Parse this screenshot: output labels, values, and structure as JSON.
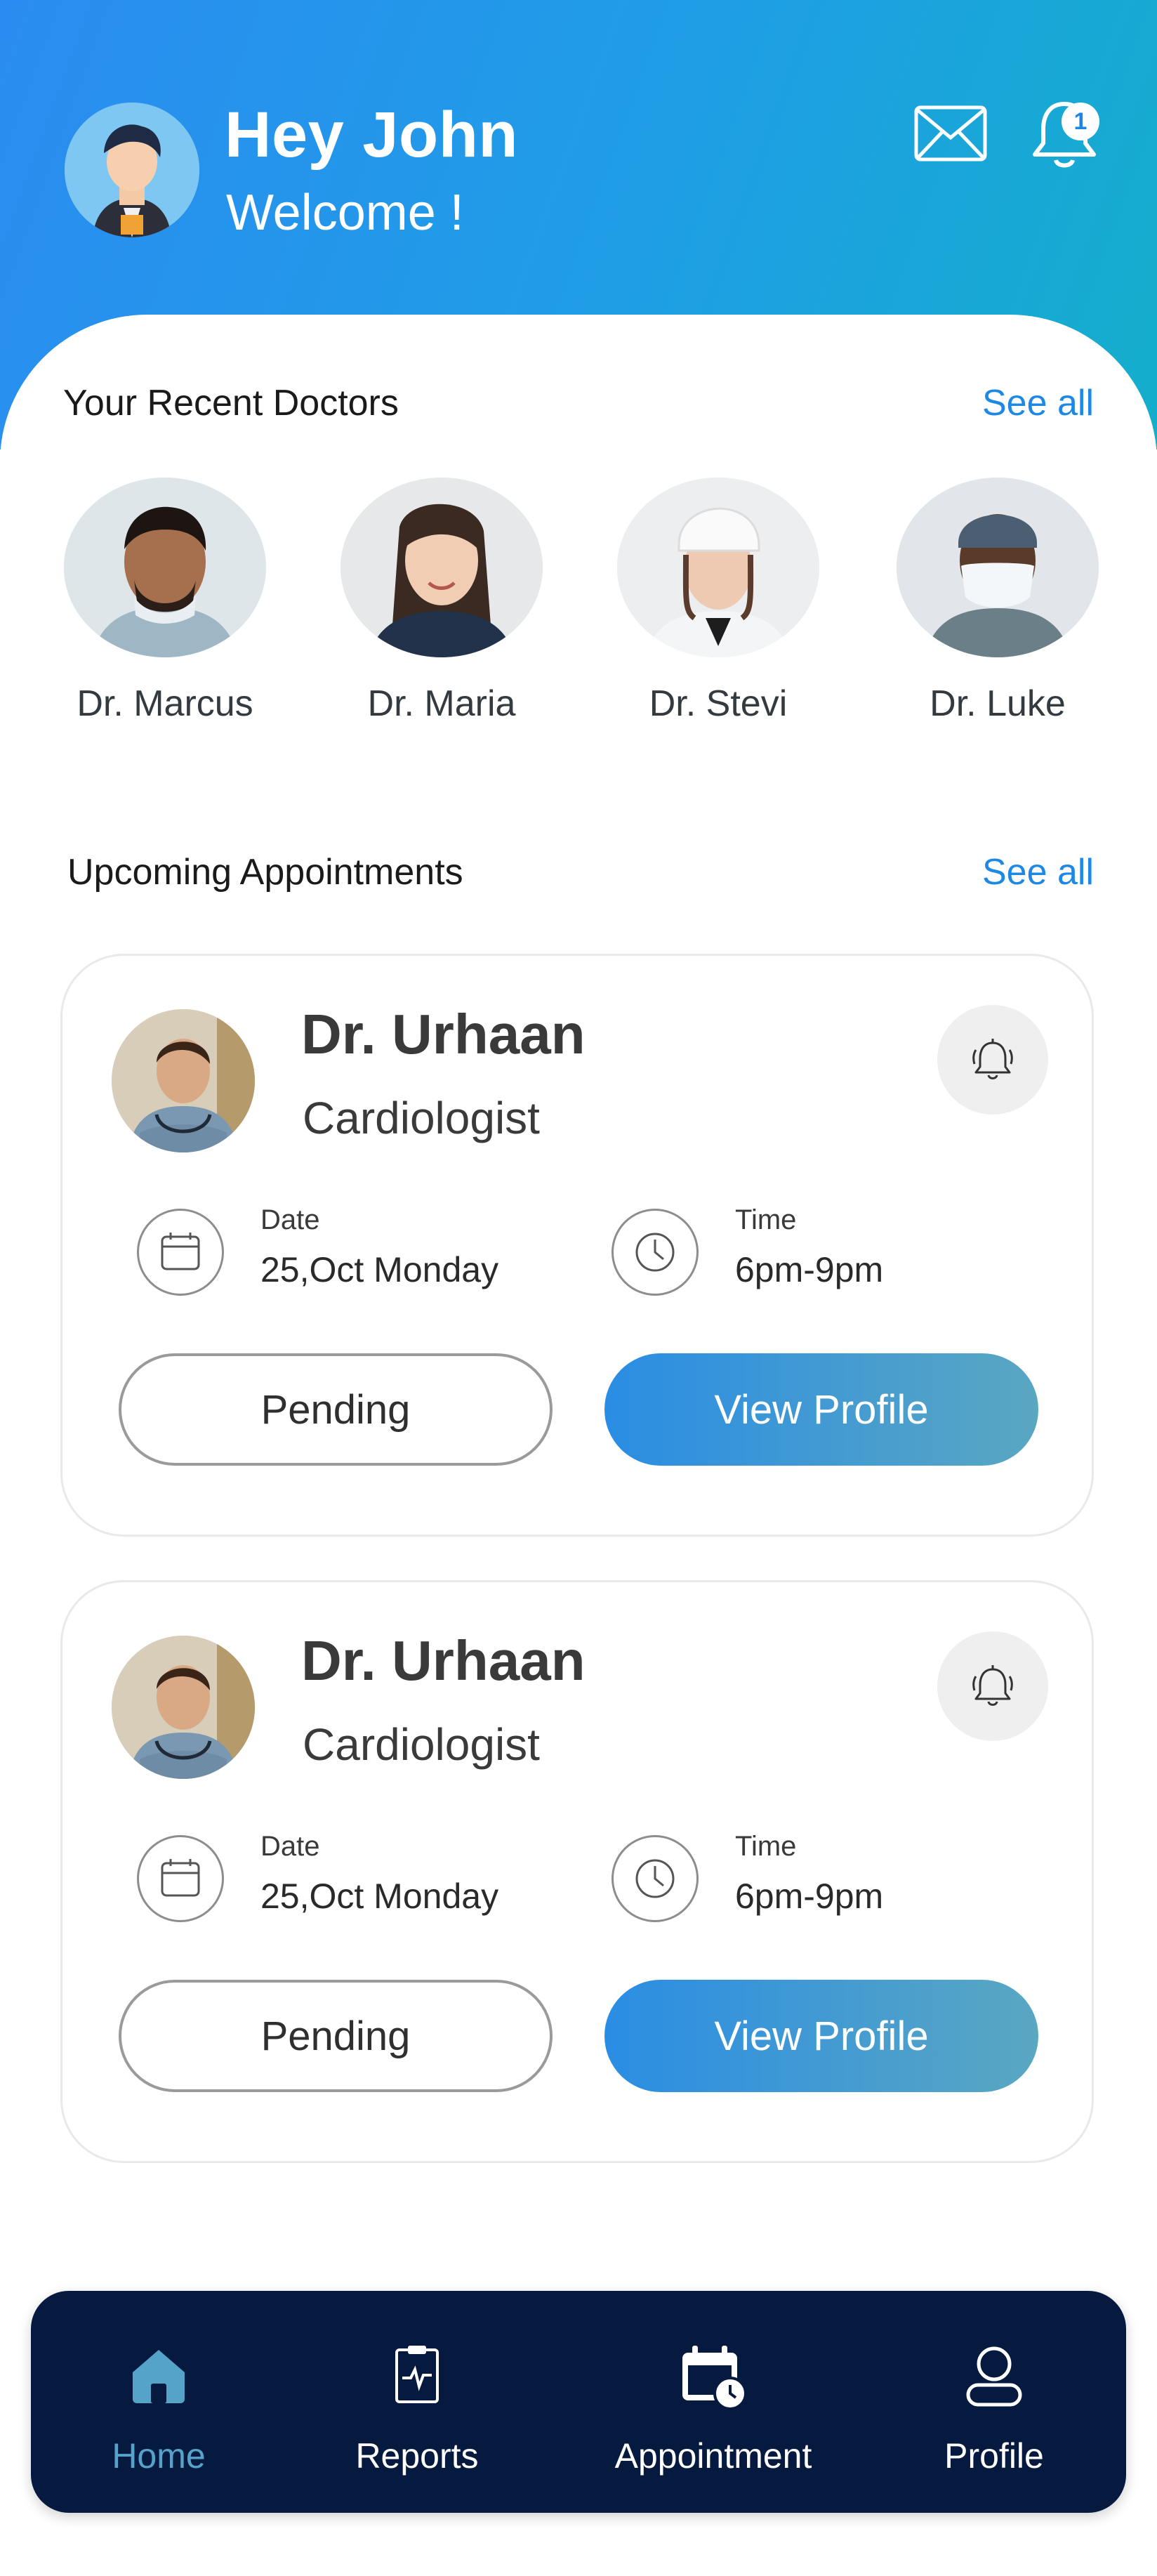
{
  "header": {
    "greeting": "Hey John",
    "subtitle": "Welcome !",
    "notification_count": "1"
  },
  "recent_doctors": {
    "title": "Your Recent Doctors",
    "see_all": "See all",
    "items": [
      {
        "name": "Dr. Marcus"
      },
      {
        "name": "Dr. Maria"
      },
      {
        "name": "Dr. Stevi"
      },
      {
        "name": "Dr. Luke"
      }
    ]
  },
  "appointments": {
    "title": "Upcoming Appointments",
    "see_all": "See all",
    "items": [
      {
        "doctor": "Dr. Urhaan",
        "specialty": "Cardiologist",
        "date_label": "Date",
        "date_value": "25,Oct Monday",
        "time_label": "Time",
        "time_value": "6pm-9pm",
        "pending_label": "Pending",
        "view_label": "View Profile"
      },
      {
        "doctor": "Dr. Urhaan",
        "specialty": "Cardiologist",
        "date_label": "Date",
        "date_value": "25,Oct Monday",
        "time_label": "Time",
        "time_value": "6pm-9pm",
        "pending_label": "Pending",
        "view_label": "View Profile"
      }
    ]
  },
  "nav": {
    "items": [
      {
        "label": "Home",
        "icon": "home-icon",
        "active": true
      },
      {
        "label": "Reports",
        "icon": "report-icon",
        "active": false
      },
      {
        "label": "Appointment",
        "icon": "calendar-clock-icon",
        "active": false
      },
      {
        "label": "Profile",
        "icon": "user-icon",
        "active": false
      }
    ]
  },
  "colors": {
    "header_gradient_start": "#2a8cf0",
    "header_gradient_end": "#14aecb",
    "accent": "#1e88e5",
    "nav_background": "#061a40",
    "nav_active": "#56a3c9"
  }
}
